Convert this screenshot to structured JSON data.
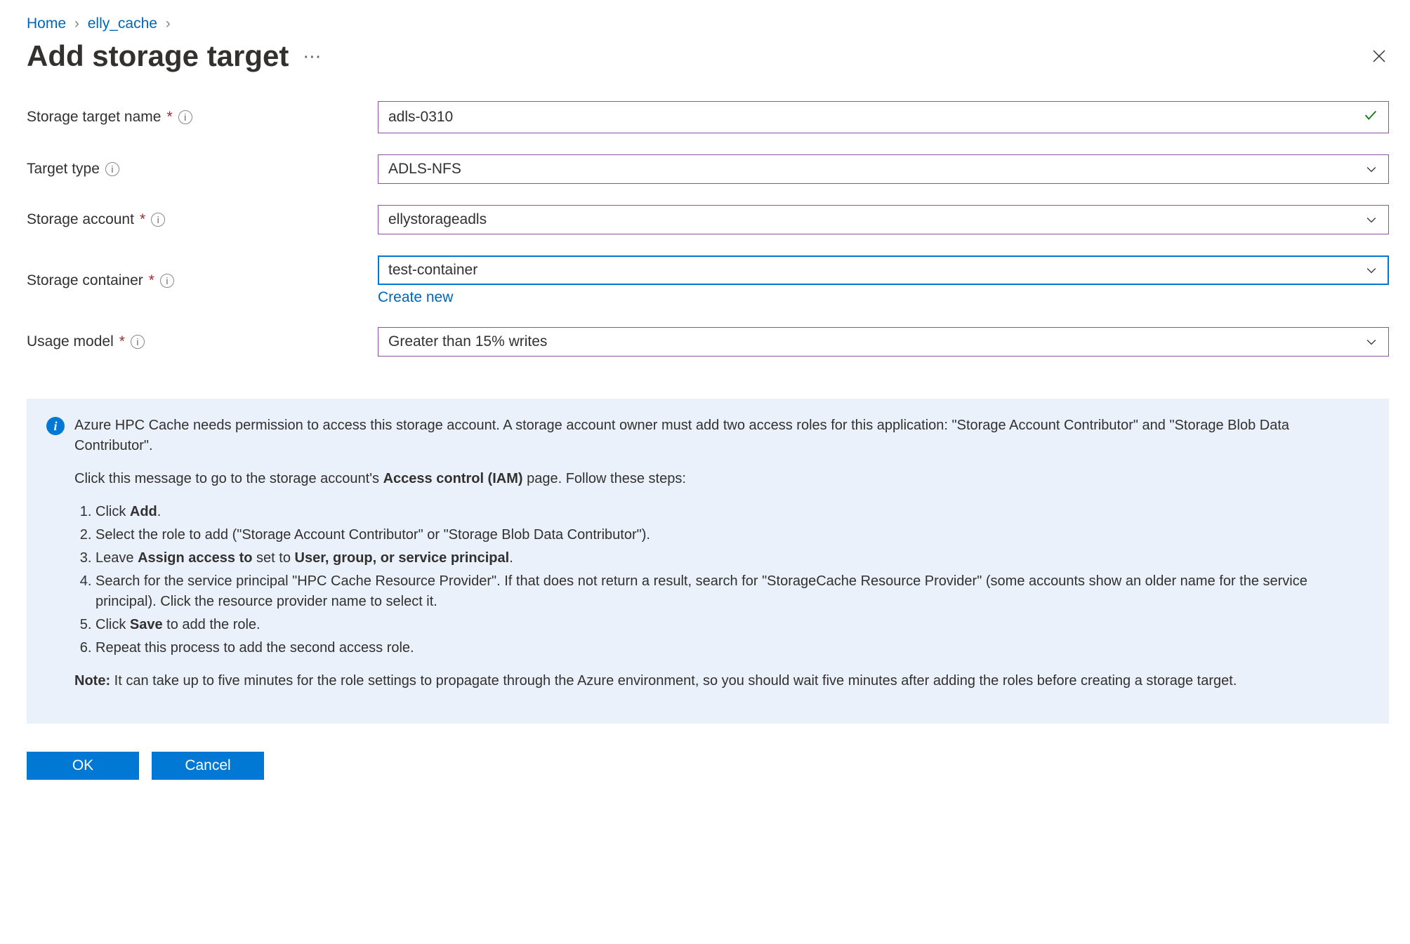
{
  "breadcrumb": {
    "home": "Home",
    "parent": "elly_cache"
  },
  "header": {
    "title": "Add storage target"
  },
  "form": {
    "storage_target_name": {
      "label": "Storage target name",
      "value": "adls-0310"
    },
    "target_type": {
      "label": "Target type",
      "value": "ADLS-NFS"
    },
    "storage_account": {
      "label": "Storage account",
      "value": "ellystorageadls"
    },
    "storage_container": {
      "label": "Storage container",
      "value": "test-container",
      "create_new": "Create new"
    },
    "usage_model": {
      "label": "Usage model",
      "value": "Greater than 15% writes"
    }
  },
  "info": {
    "para1a": "Azure HPC Cache needs permission to access this storage account. A storage account owner must add two access roles for this application: \"Storage Account Contributor\" and \"Storage Blob Data Contributor\".",
    "para2_prefix": "Click this message to go to the storage account's ",
    "para2_bold": "Access control (IAM)",
    "para2_suffix": " page. Follow these steps:",
    "step1_a": "Click ",
    "step1_b": "Add",
    "step1_c": ".",
    "step2": "Select the role to add (\"Storage Account Contributor\" or \"Storage Blob Data Contributor\").",
    "step3_a": "Leave ",
    "step3_b": "Assign access to",
    "step3_c": " set to ",
    "step3_d": "User, group, or service principal",
    "step3_e": ".",
    "step4": "Search for the service principal \"HPC Cache Resource Provider\". If that does not return a result, search for \"StorageCache Resource Provider\" (some accounts show an older name for the service principal). Click the resource provider name to select it.",
    "step5_a": "Click ",
    "step5_b": "Save",
    "step5_c": " to add the role.",
    "step6": "Repeat this process to add the second access role.",
    "note_label": "Note:",
    "note_text": " It can take up to five minutes for the role settings to propagate through the Azure environment, so you should wait five minutes after adding the roles before creating a storage target."
  },
  "buttons": {
    "ok": "OK",
    "cancel": "Cancel"
  }
}
